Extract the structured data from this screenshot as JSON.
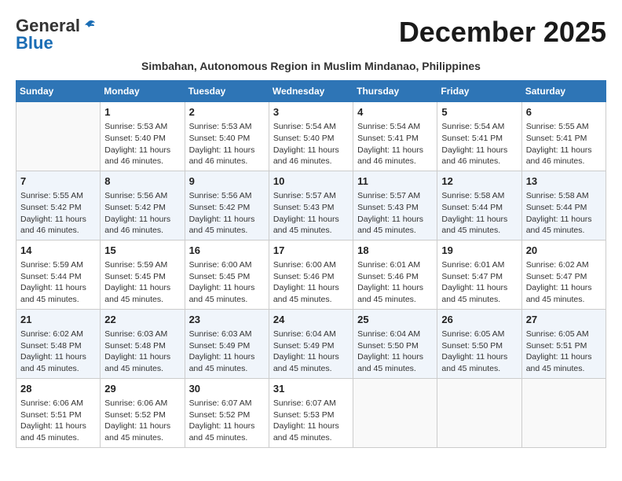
{
  "header": {
    "logo_general": "General",
    "logo_blue": "Blue",
    "month_title": "December 2025",
    "subtitle": "Simbahan, Autonomous Region in Muslim Mindanao, Philippines"
  },
  "weekdays": [
    "Sunday",
    "Monday",
    "Tuesday",
    "Wednesday",
    "Thursday",
    "Friday",
    "Saturday"
  ],
  "weeks": [
    [
      {
        "day": "",
        "sunrise": "",
        "sunset": "",
        "daylight": ""
      },
      {
        "day": "1",
        "sunrise": "Sunrise: 5:53 AM",
        "sunset": "Sunset: 5:40 PM",
        "daylight": "Daylight: 11 hours and 46 minutes."
      },
      {
        "day": "2",
        "sunrise": "Sunrise: 5:53 AM",
        "sunset": "Sunset: 5:40 PM",
        "daylight": "Daylight: 11 hours and 46 minutes."
      },
      {
        "day": "3",
        "sunrise": "Sunrise: 5:54 AM",
        "sunset": "Sunset: 5:40 PM",
        "daylight": "Daylight: 11 hours and 46 minutes."
      },
      {
        "day": "4",
        "sunrise": "Sunrise: 5:54 AM",
        "sunset": "Sunset: 5:41 PM",
        "daylight": "Daylight: 11 hours and 46 minutes."
      },
      {
        "day": "5",
        "sunrise": "Sunrise: 5:54 AM",
        "sunset": "Sunset: 5:41 PM",
        "daylight": "Daylight: 11 hours and 46 minutes."
      },
      {
        "day": "6",
        "sunrise": "Sunrise: 5:55 AM",
        "sunset": "Sunset: 5:41 PM",
        "daylight": "Daylight: 11 hours and 46 minutes."
      }
    ],
    [
      {
        "day": "7",
        "sunrise": "Sunrise: 5:55 AM",
        "sunset": "Sunset: 5:42 PM",
        "daylight": "Daylight: 11 hours and 46 minutes."
      },
      {
        "day": "8",
        "sunrise": "Sunrise: 5:56 AM",
        "sunset": "Sunset: 5:42 PM",
        "daylight": "Daylight: 11 hours and 46 minutes."
      },
      {
        "day": "9",
        "sunrise": "Sunrise: 5:56 AM",
        "sunset": "Sunset: 5:42 PM",
        "daylight": "Daylight: 11 hours and 45 minutes."
      },
      {
        "day": "10",
        "sunrise": "Sunrise: 5:57 AM",
        "sunset": "Sunset: 5:43 PM",
        "daylight": "Daylight: 11 hours and 45 minutes."
      },
      {
        "day": "11",
        "sunrise": "Sunrise: 5:57 AM",
        "sunset": "Sunset: 5:43 PM",
        "daylight": "Daylight: 11 hours and 45 minutes."
      },
      {
        "day": "12",
        "sunrise": "Sunrise: 5:58 AM",
        "sunset": "Sunset: 5:44 PM",
        "daylight": "Daylight: 11 hours and 45 minutes."
      },
      {
        "day": "13",
        "sunrise": "Sunrise: 5:58 AM",
        "sunset": "Sunset: 5:44 PM",
        "daylight": "Daylight: 11 hours and 45 minutes."
      }
    ],
    [
      {
        "day": "14",
        "sunrise": "Sunrise: 5:59 AM",
        "sunset": "Sunset: 5:44 PM",
        "daylight": "Daylight: 11 hours and 45 minutes."
      },
      {
        "day": "15",
        "sunrise": "Sunrise: 5:59 AM",
        "sunset": "Sunset: 5:45 PM",
        "daylight": "Daylight: 11 hours and 45 minutes."
      },
      {
        "day": "16",
        "sunrise": "Sunrise: 6:00 AM",
        "sunset": "Sunset: 5:45 PM",
        "daylight": "Daylight: 11 hours and 45 minutes."
      },
      {
        "day": "17",
        "sunrise": "Sunrise: 6:00 AM",
        "sunset": "Sunset: 5:46 PM",
        "daylight": "Daylight: 11 hours and 45 minutes."
      },
      {
        "day": "18",
        "sunrise": "Sunrise: 6:01 AM",
        "sunset": "Sunset: 5:46 PM",
        "daylight": "Daylight: 11 hours and 45 minutes."
      },
      {
        "day": "19",
        "sunrise": "Sunrise: 6:01 AM",
        "sunset": "Sunset: 5:47 PM",
        "daylight": "Daylight: 11 hours and 45 minutes."
      },
      {
        "day": "20",
        "sunrise": "Sunrise: 6:02 AM",
        "sunset": "Sunset: 5:47 PM",
        "daylight": "Daylight: 11 hours and 45 minutes."
      }
    ],
    [
      {
        "day": "21",
        "sunrise": "Sunrise: 6:02 AM",
        "sunset": "Sunset: 5:48 PM",
        "daylight": "Daylight: 11 hours and 45 minutes."
      },
      {
        "day": "22",
        "sunrise": "Sunrise: 6:03 AM",
        "sunset": "Sunset: 5:48 PM",
        "daylight": "Daylight: 11 hours and 45 minutes."
      },
      {
        "day": "23",
        "sunrise": "Sunrise: 6:03 AM",
        "sunset": "Sunset: 5:49 PM",
        "daylight": "Daylight: 11 hours and 45 minutes."
      },
      {
        "day": "24",
        "sunrise": "Sunrise: 6:04 AM",
        "sunset": "Sunset: 5:49 PM",
        "daylight": "Daylight: 11 hours and 45 minutes."
      },
      {
        "day": "25",
        "sunrise": "Sunrise: 6:04 AM",
        "sunset": "Sunset: 5:50 PM",
        "daylight": "Daylight: 11 hours and 45 minutes."
      },
      {
        "day": "26",
        "sunrise": "Sunrise: 6:05 AM",
        "sunset": "Sunset: 5:50 PM",
        "daylight": "Daylight: 11 hours and 45 minutes."
      },
      {
        "day": "27",
        "sunrise": "Sunrise: 6:05 AM",
        "sunset": "Sunset: 5:51 PM",
        "daylight": "Daylight: 11 hours and 45 minutes."
      }
    ],
    [
      {
        "day": "28",
        "sunrise": "Sunrise: 6:06 AM",
        "sunset": "Sunset: 5:51 PM",
        "daylight": "Daylight: 11 hours and 45 minutes."
      },
      {
        "day": "29",
        "sunrise": "Sunrise: 6:06 AM",
        "sunset": "Sunset: 5:52 PM",
        "daylight": "Daylight: 11 hours and 45 minutes."
      },
      {
        "day": "30",
        "sunrise": "Sunrise: 6:07 AM",
        "sunset": "Sunset: 5:52 PM",
        "daylight": "Daylight: 11 hours and 45 minutes."
      },
      {
        "day": "31",
        "sunrise": "Sunrise: 6:07 AM",
        "sunset": "Sunset: 5:53 PM",
        "daylight": "Daylight: 11 hours and 45 minutes."
      },
      {
        "day": "",
        "sunrise": "",
        "sunset": "",
        "daylight": ""
      },
      {
        "day": "",
        "sunrise": "",
        "sunset": "",
        "daylight": ""
      },
      {
        "day": "",
        "sunrise": "",
        "sunset": "",
        "daylight": ""
      }
    ]
  ]
}
